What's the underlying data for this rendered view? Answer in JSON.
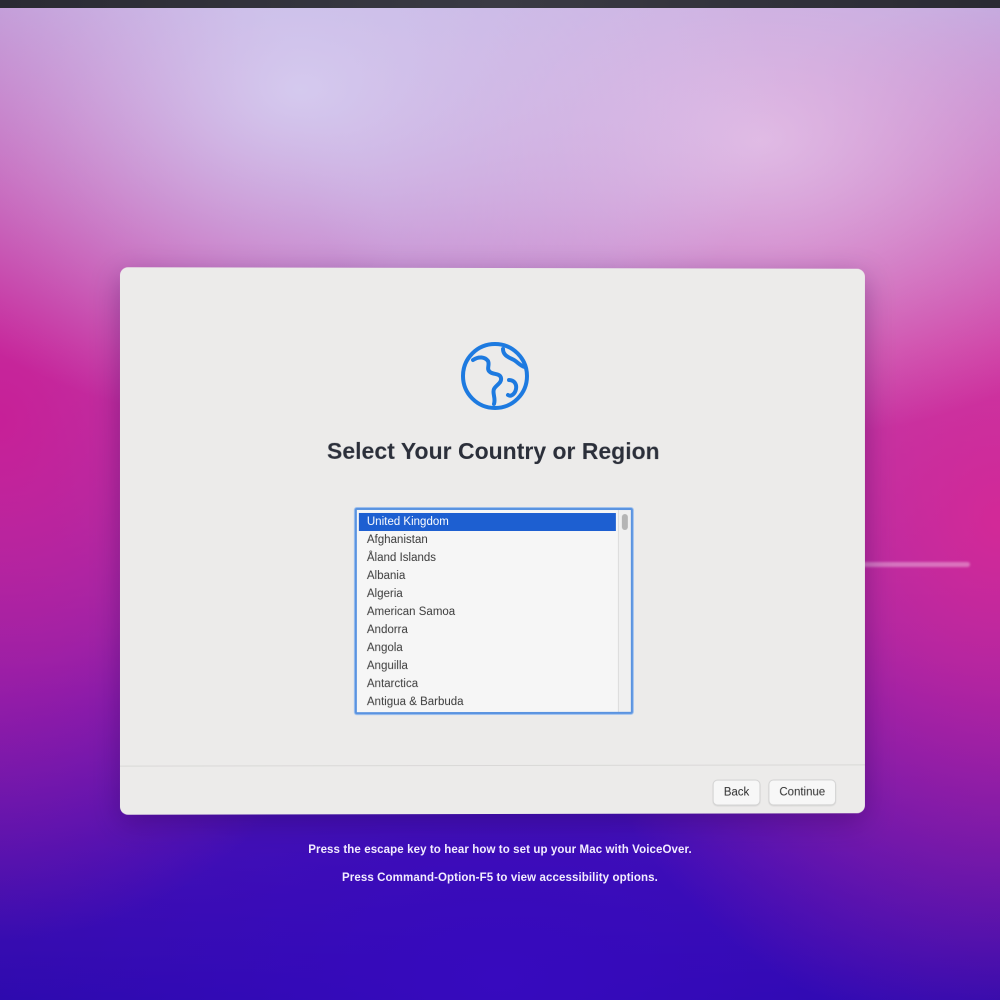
{
  "screen": {
    "title": "Select Your Country or Region",
    "icon": "globe-icon",
    "accent_color": "#1d7ae0"
  },
  "country_list": {
    "selected": "United Kingdom",
    "items": [
      "United Kingdom",
      "Afghanistan",
      "Åland Islands",
      "Albania",
      "Algeria",
      "American Samoa",
      "Andorra",
      "Angola",
      "Anguilla",
      "Antarctica",
      "Antigua & Barbuda"
    ]
  },
  "buttons": {
    "back_label": "Back",
    "continue_label": "Continue"
  },
  "hints": {
    "voiceover": "Press the escape key to hear how to set up your Mac with VoiceOver.",
    "accessibility": "Press Command-Option-F5 to view accessibility options."
  }
}
